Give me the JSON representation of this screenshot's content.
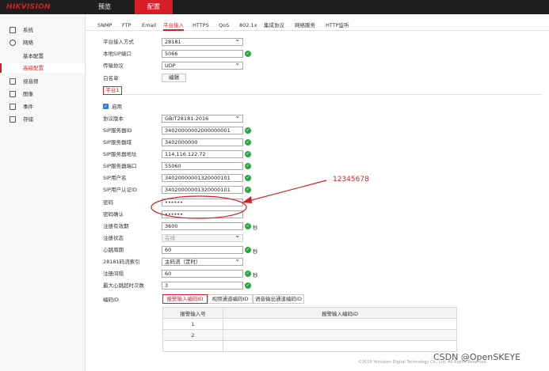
{
  "brand": {
    "logo": "HIKVISION"
  },
  "topnav": {
    "preview": "预览",
    "config": "配置"
  },
  "sidebar": {
    "items": [
      {
        "label": "系统",
        "icon": "monitor-icon"
      },
      {
        "label": "网络",
        "icon": "globe-icon"
      },
      {
        "label": "基本配置"
      },
      {
        "label": "高级配置"
      },
      {
        "label": "视音频",
        "icon": "video-audio-icon"
      },
      {
        "label": "图像",
        "icon": "image-icon"
      },
      {
        "label": "事件",
        "icon": "event-icon"
      },
      {
        "label": "存储",
        "icon": "storage-icon"
      }
    ]
  },
  "tabs": [
    "SNMP",
    "FTP",
    "Email",
    "平台接入",
    "HTTPS",
    "QoS",
    "802.1x",
    "集成协议",
    "网络服务",
    "HTTP监听"
  ],
  "top_form": {
    "access_mode_label": "平台接入方式",
    "access_mode_value": "28181",
    "local_sip_port_label": "本地SIP端口",
    "local_sip_port_value": "5066",
    "transport_label": "传输协议",
    "transport_value": "UDP",
    "whitelist_label": "白名单",
    "whitelist_button": "编辑"
  },
  "platform_tab": "平台1",
  "enable": {
    "label": "启用",
    "checked": true
  },
  "form": {
    "protocol_version": {
      "label": "协议版本",
      "value": "GB/T28181-2016"
    },
    "sip_server_id": {
      "label": "SIP服务器ID",
      "value": "34020000002000000001"
    },
    "sip_server_domain": {
      "label": "SIP服务器域",
      "value": "3402000000"
    },
    "sip_server_address": {
      "label": "SIP服务器地址",
      "value": "114.116.122.72"
    },
    "sip_server_port": {
      "label": "SIP服务器端口",
      "value": "55060"
    },
    "sip_username": {
      "label": "SIP用户名",
      "value": "34020000001320000101"
    },
    "sip_auth_id": {
      "label": "SIP用户认证ID",
      "value": "34020000001320000101"
    },
    "password": {
      "label": "密码",
      "value": "••••••"
    },
    "password_confirm": {
      "label": "密码确认",
      "value": "••••••"
    },
    "register_validity": {
      "label": "注册有效期",
      "value": "3600",
      "unit": "秒"
    },
    "register_status": {
      "label": "注册状态",
      "value": "在线"
    },
    "heartbeat_period": {
      "label": "心跳周期",
      "value": "60",
      "unit": "秒"
    },
    "stream_index": {
      "label": "28181码流索引",
      "value": "主码流（定时）"
    },
    "register_interval": {
      "label": "注册间隔",
      "value": "60",
      "unit": "秒"
    },
    "max_heartbeat_timeout": {
      "label": "最大心跳超时次数",
      "value": "3"
    }
  },
  "encoding_id": {
    "label": "编码ID",
    "tabs": [
      "报警输入编码ID",
      "视频通道编码ID",
      "语音输出通道编码ID"
    ],
    "table_headers": [
      "报警输入号",
      "报警输入编码ID"
    ],
    "rows": [
      [
        "1",
        ""
      ],
      [
        "2",
        ""
      ],
      [
        "",
        ""
      ]
    ]
  },
  "annotation": "12345678",
  "annotation_color": "#d71e26",
  "footer": "©2019 Hikvision Digital Technology Co., Ltd. All Rights Reserved.",
  "watermark": "CSDN @OpenSKEYE",
  "colors": {
    "accent": "#d71e26",
    "ok": "#2aa644",
    "topbar": "#1e1e1e"
  }
}
